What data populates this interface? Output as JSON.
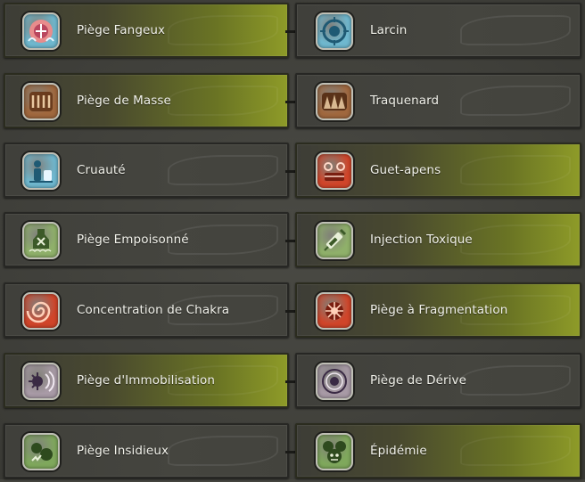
{
  "rows": [
    {
      "left": {
        "label": "Piège Fangeux",
        "icon": "mud-trap-icon",
        "color": "#6fb8cf",
        "active": true
      },
      "right": {
        "label": "Larcin",
        "icon": "larceny-icon",
        "color": "#6fb8cf",
        "active": false
      }
    },
    {
      "left": {
        "label": "Piège de Masse",
        "icon": "mass-trap-icon",
        "color": "#a0683e",
        "active": true
      },
      "right": {
        "label": "Traquenard",
        "icon": "ambush-trap-icon",
        "color": "#a0683e",
        "active": false
      }
    },
    {
      "left": {
        "label": "Cruauté",
        "icon": "cruelty-icon",
        "color": "#6fb8cf",
        "active": false
      },
      "right": {
        "label": "Guet-apens",
        "icon": "guet-apens-icon",
        "color": "#d0452a",
        "active": true
      }
    },
    {
      "left": {
        "label": "Piège Empoisonné",
        "icon": "poisoned-trap-icon",
        "color": "#8fb06a",
        "active": false
      },
      "right": {
        "label": "Injection Toxique",
        "icon": "toxic-injection-icon",
        "color": "#8fb06a",
        "active": true
      }
    },
    {
      "left": {
        "label": "Concentration de Chakra",
        "icon": "chakra-concentration-icon",
        "color": "#d0452a",
        "active": false
      },
      "right": {
        "label": "Piège à Fragmentation",
        "icon": "fragmentation-trap-icon",
        "color": "#d0452a",
        "active": true
      }
    },
    {
      "left": {
        "label": "Piège d'Immobilisation",
        "icon": "immobilisation-trap-icon",
        "color": "#a89aa6",
        "active": true
      },
      "right": {
        "label": "Piège de Dérive",
        "icon": "drift-trap-icon",
        "color": "#a89aa6",
        "active": false
      }
    },
    {
      "left": {
        "label": "Piège Insidieux",
        "icon": "insidious-trap-icon",
        "color": "#7fa85c",
        "active": false
      },
      "right": {
        "label": "Épidémie",
        "icon": "epidemic-icon",
        "color": "#7fa85c",
        "active": true
      }
    }
  ]
}
